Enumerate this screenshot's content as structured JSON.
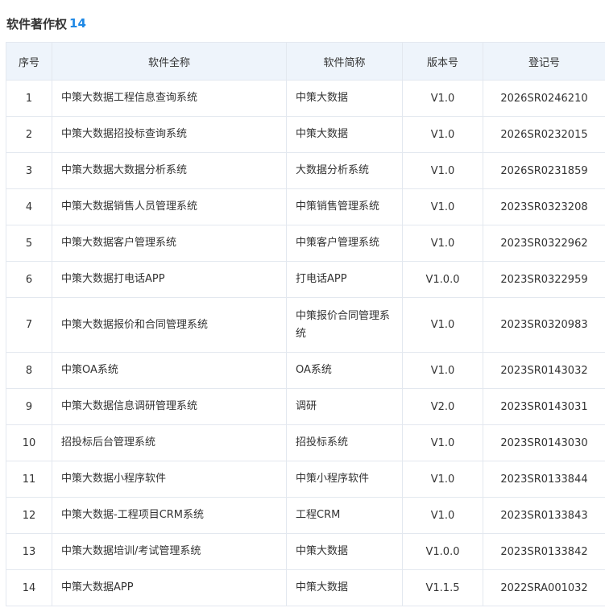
{
  "header": {
    "title": "软件著作权",
    "count": "14"
  },
  "table": {
    "columns": [
      "序号",
      "软件全称",
      "软件简称",
      "版本号",
      "登记号"
    ],
    "rows": [
      {
        "no": "1",
        "full_name": "中策大数据工程信息查询系统",
        "short_name": "中策大数据",
        "version": "V1.0",
        "reg_no": "2026SR0246210"
      },
      {
        "no": "2",
        "full_name": "中策大数据招投标查询系统",
        "short_name": "中策大数据",
        "version": "V1.0",
        "reg_no": "2026SR0232015"
      },
      {
        "no": "3",
        "full_name": "中策大数据大数据分析系统",
        "short_name": "大数据分析系统",
        "version": "V1.0",
        "reg_no": "2026SR0231859"
      },
      {
        "no": "4",
        "full_name": "中策大数据销售人员管理系统",
        "short_name": "中策销售管理系统",
        "version": "V1.0",
        "reg_no": "2023SR0323208"
      },
      {
        "no": "5",
        "full_name": "中策大数据客户管理系统",
        "short_name": "中策客户管理系统",
        "version": "V1.0",
        "reg_no": "2023SR0322962"
      },
      {
        "no": "6",
        "full_name": "中策大数据打电话APP",
        "short_name": "打电话APP",
        "version": "V1.0.0",
        "reg_no": "2023SR0322959"
      },
      {
        "no": "7",
        "full_name": "中策大数据报价和合同管理系统",
        "short_name": "中策报价合同管理系统",
        "version": "V1.0",
        "reg_no": "2023SR0320983"
      },
      {
        "no": "8",
        "full_name": "中策OA系统",
        "short_name": "OA系统",
        "version": "V1.0",
        "reg_no": "2023SR0143032"
      },
      {
        "no": "9",
        "full_name": "中策大数据信息调研管理系统",
        "short_name": "调研",
        "version": "V2.0",
        "reg_no": "2023SR0143031"
      },
      {
        "no": "10",
        "full_name": "招投标后台管理系统",
        "short_name": "招投标系统",
        "version": "V1.0",
        "reg_no": "2023SR0143030"
      },
      {
        "no": "11",
        "full_name": "中策大数据小程序软件",
        "short_name": "中策小程序软件",
        "version": "V1.0",
        "reg_no": "2023SR0133844"
      },
      {
        "no": "12",
        "full_name": "中策大数据-工程项目CRM系统",
        "short_name": "工程CRM",
        "version": "V1.0",
        "reg_no": "2023SR0133843"
      },
      {
        "no": "13",
        "full_name": "中策大数据培训/考试管理系统",
        "short_name": "中策大数据",
        "version": "V1.0.0",
        "reg_no": "2023SR0133842"
      },
      {
        "no": "14",
        "full_name": "中策大数据APP",
        "short_name": "中策大数据",
        "version": "V1.1.5",
        "reg_no": "2022SRA001032"
      }
    ]
  }
}
